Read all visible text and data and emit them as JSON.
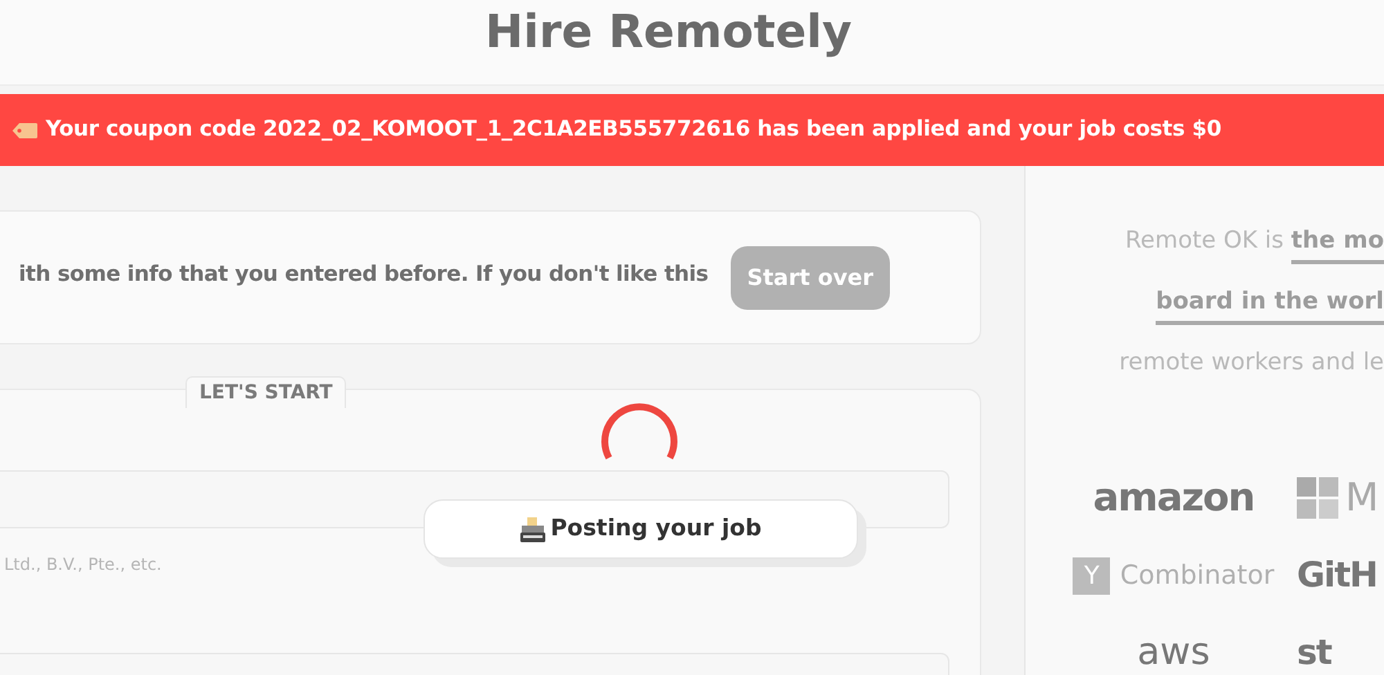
{
  "page_title": "Hire Remotely",
  "banner": {
    "text": "Your coupon code 2022_02_KOMOOT_1_2C1A2EB555772616 has been applied and your job costs $0"
  },
  "notice": {
    "text": "ith some info that you entered before. If you don't like this",
    "button": "Start over"
  },
  "form": {
    "section_label": "LET'S START",
    "field_hint": "Ltd., B.V., Pte., etc."
  },
  "loading": {
    "message": "Posting your job"
  },
  "sidebar": {
    "lines": [
      {
        "text": "Remote OK is ",
        "link": "the mo"
      },
      {
        "link": "board in the worl"
      },
      {
        "text": "remote workers and le"
      }
    ],
    "logos": [
      {
        "kind": "smile",
        "text": "amazon"
      },
      {
        "kind": "tiles",
        "text": "M"
      },
      {
        "kind": "badge",
        "mark": "Y",
        "text": "Combinator"
      },
      {
        "kind": "heavy",
        "text": "GitH"
      },
      {
        "kind": "plain",
        "text": "aws"
      },
      {
        "kind": "heavy",
        "text": "st"
      }
    ]
  }
}
